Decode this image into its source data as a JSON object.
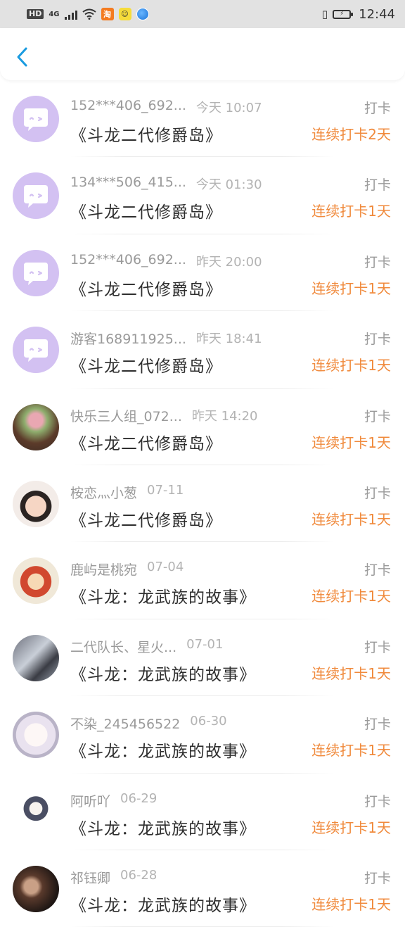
{
  "status_bar": {
    "hd": "HD",
    "network": "4G",
    "taobao_label": "淘",
    "time": "12:44"
  },
  "header": {
    "back_icon": "chevron-left-icon"
  },
  "colors": {
    "accent_orange": "#f08a3c",
    "back_blue": "#1a9be0",
    "default_avatar": "#d3c1f2"
  },
  "records": [
    {
      "name": "152***406_692...",
      "time": "今天 10:07",
      "book": "《斗龙二代修爵岛》",
      "tag": "打卡",
      "streak": "连续打卡2天",
      "avatar": "default"
    },
    {
      "name": "134***506_415...",
      "time": "今天 01:30",
      "book": "《斗龙二代修爵岛》",
      "tag": "打卡",
      "streak": "连续打卡1天",
      "avatar": "default"
    },
    {
      "name": "152***406_692...",
      "time": "昨天 20:00",
      "book": "《斗龙二代修爵岛》",
      "tag": "打卡",
      "streak": "连续打卡1天",
      "avatar": "default"
    },
    {
      "name": "游客168911925...",
      "time": "昨天 18:41",
      "book": "《斗龙二代修爵岛》",
      "tag": "打卡",
      "streak": "连续打卡1天",
      "avatar": "default"
    },
    {
      "name": "快乐三人组_072...",
      "time": "昨天 14:20",
      "book": "《斗龙二代修爵岛》",
      "tag": "打卡",
      "streak": "连续打卡1天",
      "avatar": "photo-flowers"
    },
    {
      "name": "桉恋灬小葱",
      "time": "07-11",
      "book": "《斗龙二代修爵岛》",
      "tag": "打卡",
      "streak": "连续打卡1天",
      "avatar": "photo-child"
    },
    {
      "name": "鹿屿是桃宛",
      "time": "07-04",
      "book": "《斗龙：龙武族的故事》",
      "tag": "打卡",
      "streak": "连续打卡1天",
      "avatar": "photo-cartoon-girl"
    },
    {
      "name": "二代队长、星火...",
      "time": "07-01",
      "book": "《斗龙：龙武族的故事》",
      "tag": "打卡",
      "streak": "连续打卡1天",
      "avatar": "photo-anime"
    },
    {
      "name": "不染_245456522",
      "time": "06-30",
      "book": "《斗龙：龙武族的故事》",
      "tag": "打卡",
      "streak": "连续打卡1天",
      "avatar": "photo-anime-white"
    },
    {
      "name": "阿听吖",
      "time": "06-29",
      "book": "《斗龙：龙武族的故事》",
      "tag": "打卡",
      "streak": "连续打卡1天",
      "avatar": "photo-sketch"
    },
    {
      "name": "祁钰卿",
      "time": "06-28",
      "book": "《斗龙：龙武族的故事》",
      "tag": "打卡",
      "streak": "连续打卡1天",
      "avatar": "photo-dark"
    }
  ]
}
